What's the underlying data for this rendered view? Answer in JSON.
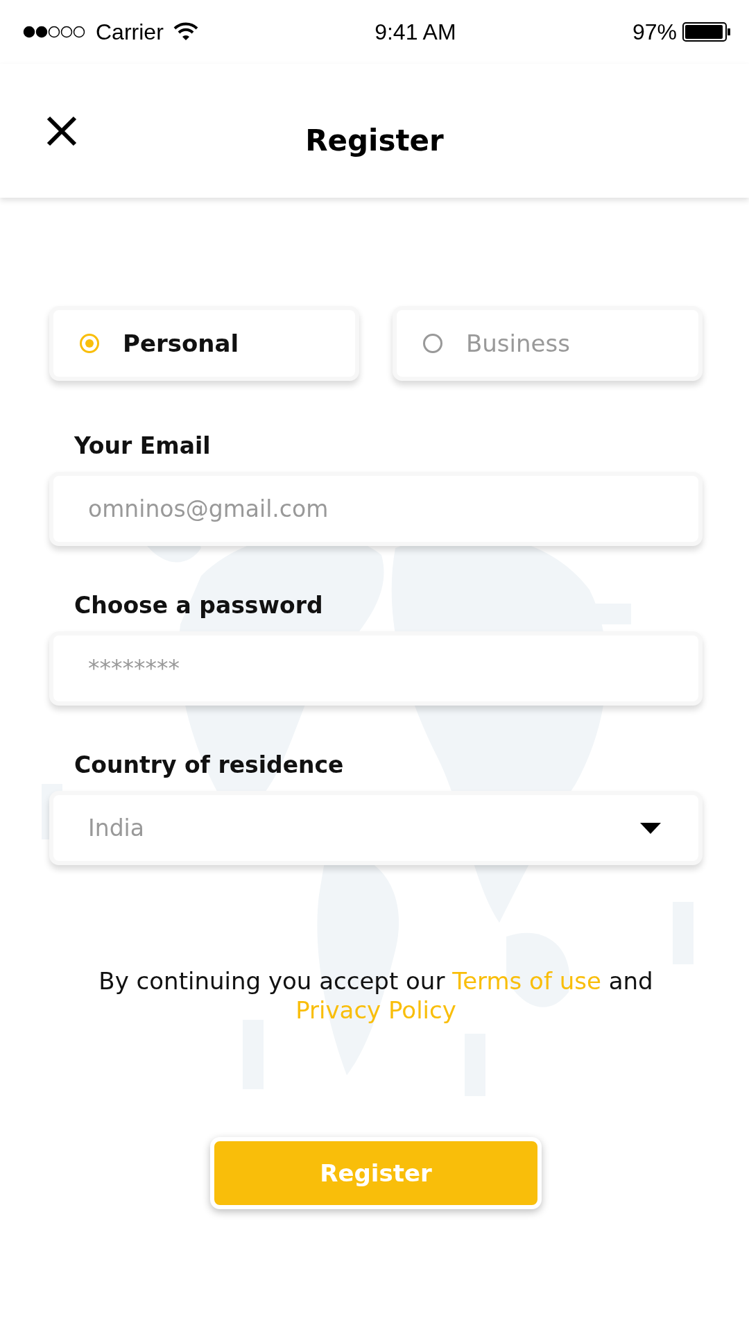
{
  "status_bar": {
    "carrier": "Carrier",
    "time": "9:41 AM",
    "battery": "97%"
  },
  "header": {
    "title": "Register"
  },
  "account_types": [
    {
      "label": "Personal",
      "selected": true
    },
    {
      "label": "Business",
      "selected": false
    }
  ],
  "fields": [
    {
      "kind": "text",
      "label": "Your Email",
      "placeholder": "omninos@gmail.com"
    },
    {
      "kind": "password",
      "label": "Choose a password",
      "placeholder": "********"
    },
    {
      "kind": "select",
      "label": "Country of residence",
      "value": "India"
    }
  ],
  "terms": {
    "before": "By continuing you accept our",
    "terms_link": "Terms of use",
    "middle": "and",
    "privacy_link": "Privacy Policy"
  },
  "submit_button": "Register"
}
